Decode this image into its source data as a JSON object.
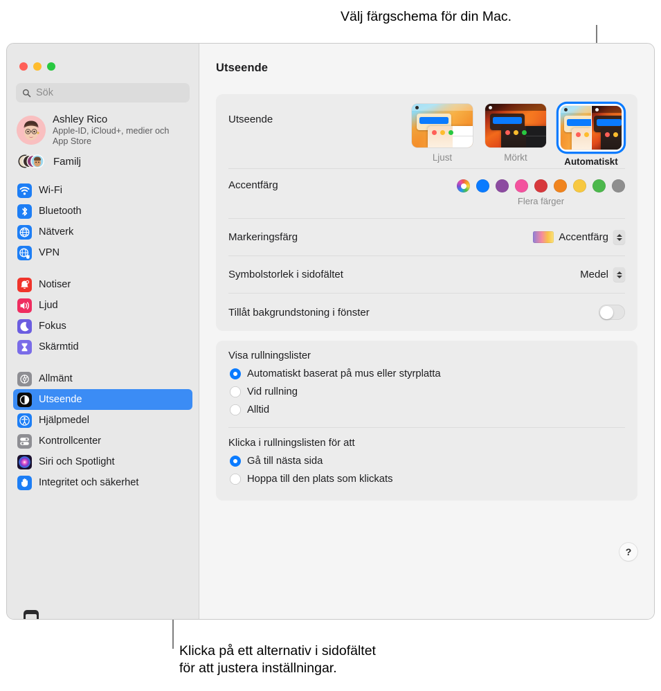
{
  "callouts": {
    "top": "Välj färgschema för din Mac.",
    "bottom": "Klicka på ett alternativ i sidofältet\nför att justera inställningar."
  },
  "window": {
    "title": "Utseende"
  },
  "sidebar": {
    "search": {
      "placeholder": "Sök"
    },
    "account": {
      "name": "Ashley Rico",
      "subtitle": "Apple-ID, iCloud+, medier och App Store"
    },
    "family": {
      "label": "Familj"
    },
    "groups": [
      {
        "items": [
          {
            "label": "Wi-Fi",
            "icon": "wifi-icon",
            "selected": false
          },
          {
            "label": "Bluetooth",
            "icon": "bluetooth-icon",
            "selected": false
          },
          {
            "label": "Nätverk",
            "icon": "network-globe-icon",
            "selected": false
          },
          {
            "label": "VPN",
            "icon": "vpn-globe-icon",
            "selected": false
          }
        ]
      },
      {
        "items": [
          {
            "label": "Notiser",
            "icon": "bell-icon",
            "selected": false
          },
          {
            "label": "Ljud",
            "icon": "speaker-icon",
            "selected": false
          },
          {
            "label": "Fokus",
            "icon": "moon-icon",
            "selected": false
          },
          {
            "label": "Skärmtid",
            "icon": "hourglass-icon",
            "selected": false
          }
        ]
      },
      {
        "items": [
          {
            "label": "Allmänt",
            "icon": "gear-icon",
            "selected": false
          },
          {
            "label": "Utseende",
            "icon": "appearance-icon",
            "selected": true
          },
          {
            "label": "Hjälpmedel",
            "icon": "accessibility-icon",
            "selected": false
          },
          {
            "label": "Kontrollcenter",
            "icon": "control-center-icon",
            "selected": false
          },
          {
            "label": "Siri och Spotlight",
            "icon": "siri-icon",
            "selected": false
          },
          {
            "label": "Integritet och säkerhet",
            "icon": "hand-privacy-icon",
            "selected": false
          }
        ]
      }
    ]
  },
  "detail": {
    "appearance": {
      "label": "Utseende",
      "options": [
        {
          "label": "Ljust",
          "selected": false
        },
        {
          "label": "Mörkt",
          "selected": false
        },
        {
          "label": "Automatiskt",
          "selected": true
        }
      ]
    },
    "accent": {
      "label": "Accentfärg",
      "more_colors": "Flera färger",
      "swatches": [
        {
          "name": "multicolor",
          "color": "multi"
        },
        {
          "name": "blue",
          "color": "#0a7bff"
        },
        {
          "name": "purple",
          "color": "#8c4ba0"
        },
        {
          "name": "pink",
          "color": "#f3529e"
        },
        {
          "name": "red",
          "color": "#d7383c"
        },
        {
          "name": "orange",
          "color": "#f0841e"
        },
        {
          "name": "yellow",
          "color": "#f7c840"
        },
        {
          "name": "green",
          "color": "#4cb councils"
        },
        {
          "name": "graphite",
          "color": "#8e8e8e"
        }
      ]
    },
    "highlight": {
      "label": "Markeringsfärg",
      "value": "Accentfärg"
    },
    "sidebar_icon_size": {
      "label": "Symbolstorlek i sidofältet",
      "value": "Medel"
    },
    "allow_tinting": {
      "label": "Tillåt bakgrundstoning i fönster",
      "on": false
    },
    "show_scrollbars": {
      "label": "Visa rullningslister",
      "options": [
        {
          "label": "Automatiskt baserat på mus eller styrplatta",
          "selected": true
        },
        {
          "label": "Vid rullning",
          "selected": false
        },
        {
          "label": "Alltid",
          "selected": false
        }
      ]
    },
    "click_scrollbar": {
      "label": "Klicka i rullningslisten för att",
      "options": [
        {
          "label": "Gå till nästa sida",
          "selected": true
        },
        {
          "label": "Hoppa till den plats som klickats",
          "selected": false
        }
      ]
    },
    "help": {
      "label": "?"
    }
  }
}
